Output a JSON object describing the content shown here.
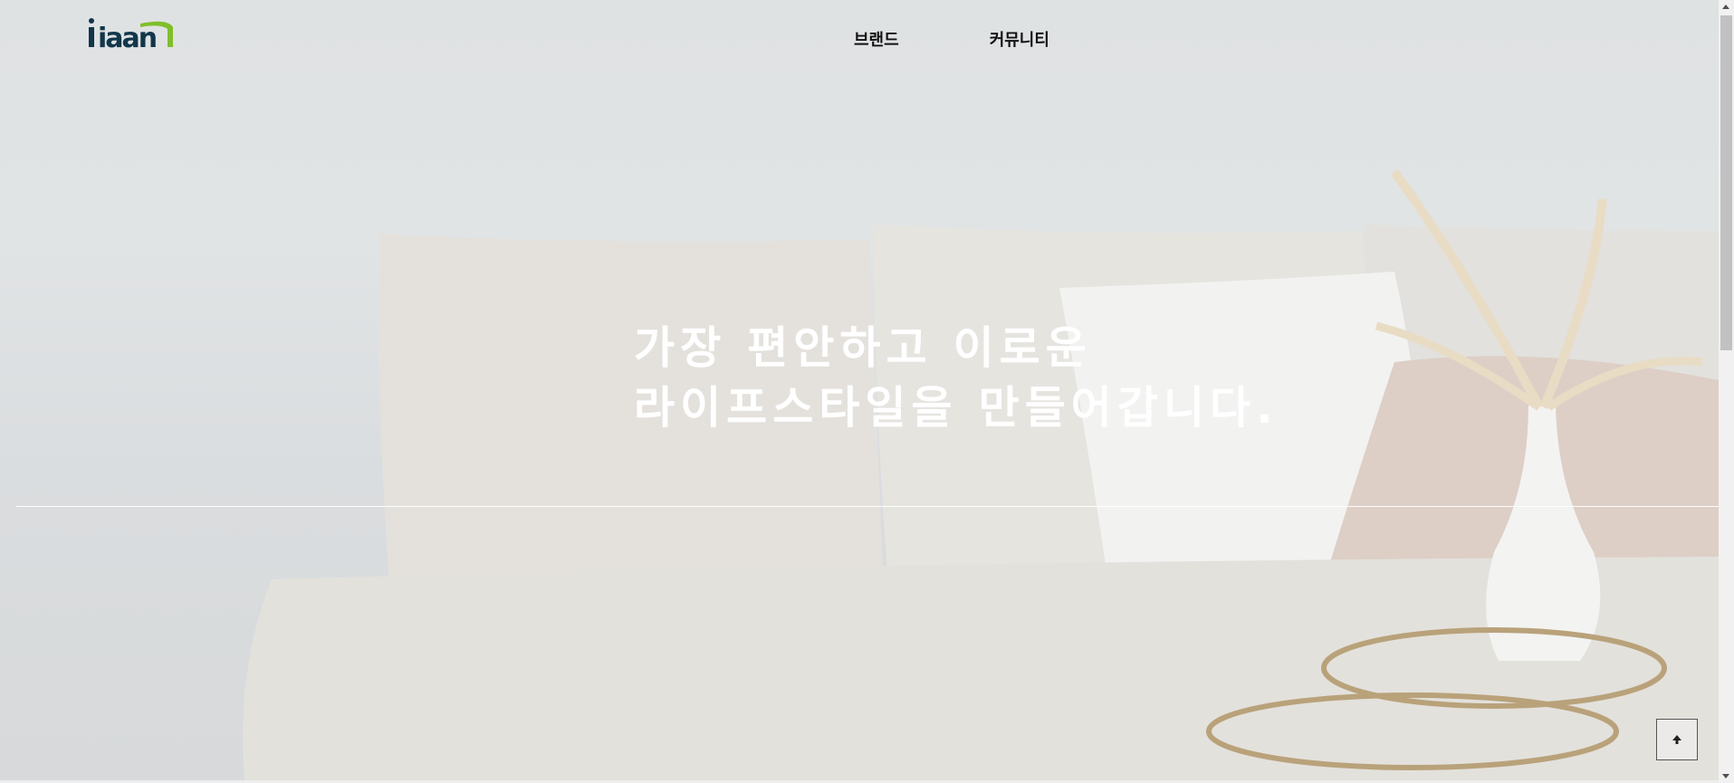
{
  "header": {
    "logo_text": "iaan",
    "nav": [
      {
        "label": "브랜드"
      },
      {
        "label": "커뮤니티"
      }
    ]
  },
  "hero": {
    "headline_line1": "가장 편안하고 이로운",
    "headline_line2": "라이프스타일을 만들어갑니다."
  },
  "colors": {
    "logo_primary": "#12364a",
    "logo_accent": "#7fbf2a",
    "headline": "#ffffff"
  },
  "icons": {
    "back_to_top": "arrow-up-icon"
  }
}
